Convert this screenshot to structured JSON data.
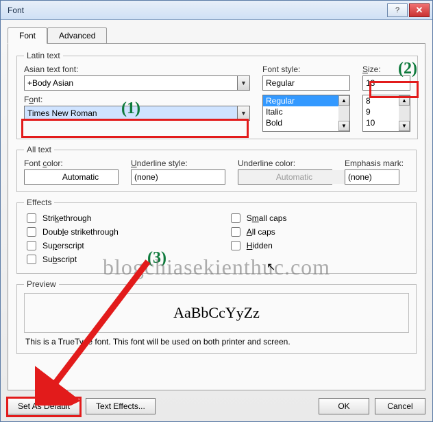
{
  "window": {
    "title": "Font"
  },
  "tabs": {
    "font": "Font",
    "advanced": "Advanced"
  },
  "latin": {
    "legend": "Latin text",
    "asian_label": "Asian text font:",
    "asian_value": "+Body Asian",
    "font_label": "Font:",
    "font_value": "Times New Roman",
    "style_label": "Font style:",
    "style_value": "Regular",
    "style_options": [
      "Regular",
      "Italic",
      "Bold"
    ],
    "size_label": "Size:",
    "size_value": "13",
    "size_options": [
      "8",
      "9",
      "10"
    ]
  },
  "alltext": {
    "legend": "All text",
    "font_color_label": "Font color:",
    "font_color_value": "Automatic",
    "underline_style_label": "Underline style:",
    "underline_style_value": "(none)",
    "underline_color_label": "Underline color:",
    "underline_color_value": "Automatic",
    "emphasis_label": "Emphasis mark:",
    "emphasis_value": "(none)"
  },
  "effects": {
    "legend": "Effects",
    "strike": "Strikethrough",
    "dstrike": "Double strikethrough",
    "superscript": "Superscript",
    "subscript": "Subscript",
    "smallcaps": "Small caps",
    "allcaps": "All caps",
    "hidden": "Hidden"
  },
  "preview": {
    "legend": "Preview",
    "sample": "AaBbCcYyZz",
    "note": "This is a TrueType font. This font will be used on both printer and screen."
  },
  "buttons": {
    "set_default": "Set As Default",
    "text_effects": "Text Effects...",
    "ok": "OK",
    "cancel": "Cancel"
  },
  "annotations": {
    "n1": "(1)",
    "n2": "(2)",
    "n3": "(3)",
    "watermark": "blogchiasekienthuc.com"
  }
}
